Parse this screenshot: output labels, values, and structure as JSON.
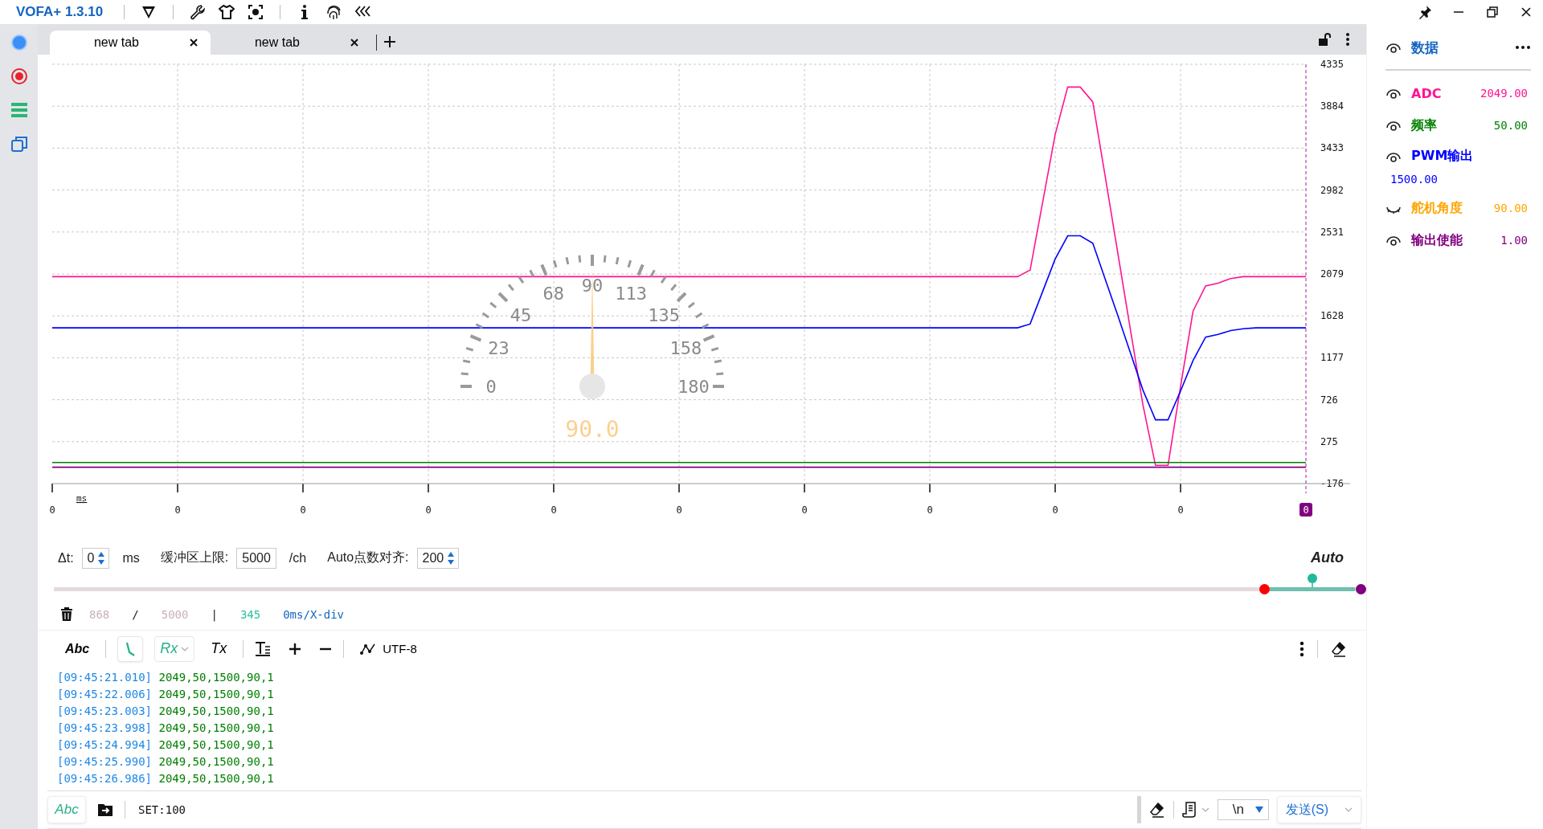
{
  "app": {
    "title": "VOFA+ 1.3.10"
  },
  "tabs": [
    {
      "label": "new tab",
      "selected": true
    },
    {
      "label": "new tab",
      "selected": false
    }
  ],
  "chart": {
    "unit_label": "ms",
    "chart_data": {
      "type": "line",
      "grid": true,
      "categories": [
        "0",
        null,
        null,
        null,
        null,
        null,
        null,
        null,
        null,
        null,
        "0",
        null,
        null,
        null,
        null,
        null,
        null,
        null,
        null,
        null,
        "0",
        null,
        null,
        null,
        null,
        null,
        null,
        null,
        null,
        null,
        "0",
        null,
        null,
        null,
        null,
        null,
        null,
        null,
        null,
        null,
        "0",
        null,
        null,
        null,
        null,
        null,
        null,
        null,
        null,
        null,
        "0",
        null,
        null,
        null,
        null,
        null,
        null,
        null,
        null,
        null,
        "0",
        null,
        null,
        null,
        null,
        null,
        null,
        null,
        null,
        null,
        "0",
        null,
        null,
        null,
        null,
        null,
        null,
        null,
        null,
        null,
        "0",
        null,
        null,
        null,
        null,
        null,
        null,
        null,
        null,
        null,
        "0",
        null,
        null,
        null,
        null,
        null,
        null,
        null,
        null,
        null,
        "0"
      ],
      "series": [
        {
          "color": "#ff1493",
          "values": [
            2050,
            2050,
            2050,
            2050,
            2050,
            2050,
            2050,
            2050,
            2050,
            2050,
            2050,
            2050,
            2050,
            2050,
            2050,
            2050,
            2050,
            2050,
            2050,
            2050,
            2050,
            2050,
            2050,
            2050,
            2050,
            2050,
            2050,
            2050,
            2050,
            2050,
            2050,
            2050,
            2050,
            2050,
            2050,
            2050,
            2050,
            2050,
            2050,
            2050,
            2050,
            2050,
            2050,
            2050,
            2050,
            2050,
            2050,
            2050,
            2050,
            2050,
            2050,
            2050,
            2050,
            2050,
            2050,
            2050,
            2050,
            2050,
            2050,
            2050,
            2050,
            2050,
            2050,
            2050,
            2050,
            2050,
            2050,
            2050,
            2050,
            2050,
            2050,
            2050,
            2050,
            2050,
            2050,
            2050,
            2050,
            2050,
            2120,
            2850,
            3580,
            4090,
            4090,
            3930,
            3120,
            2300,
            1480,
            670,
            20,
            20,
            870,
            1680,
            1950,
            1980,
            2030,
            2050,
            2050,
            2050,
            2050,
            2050,
            2050
          ]
        },
        {
          "color": "#0000ff",
          "values": [
            1500,
            1500,
            1500,
            1500,
            1500,
            1500,
            1500,
            1500,
            1500,
            1500,
            1500,
            1500,
            1500,
            1500,
            1500,
            1500,
            1500,
            1500,
            1500,
            1500,
            1500,
            1500,
            1500,
            1500,
            1500,
            1500,
            1500,
            1500,
            1500,
            1500,
            1500,
            1500,
            1500,
            1500,
            1500,
            1500,
            1500,
            1500,
            1500,
            1500,
            1500,
            1500,
            1500,
            1500,
            1500,
            1500,
            1500,
            1500,
            1500,
            1500,
            1500,
            1500,
            1500,
            1500,
            1500,
            1500,
            1500,
            1500,
            1500,
            1500,
            1500,
            1500,
            1500,
            1500,
            1500,
            1500,
            1500,
            1500,
            1500,
            1500,
            1500,
            1500,
            1500,
            1500,
            1500,
            1500,
            1500,
            1500,
            1540,
            1890,
            2240,
            2490,
            2490,
            2410,
            2020,
            1630,
            1230,
            830,
            510,
            510,
            820,
            1150,
            1400,
            1430,
            1470,
            1490,
            1500,
            1500,
            1500,
            1500,
            1500
          ]
        },
        {
          "color": "#008000",
          "values": [
            50,
            50,
            50,
            50,
            50,
            50,
            50,
            50,
            50,
            50,
            50,
            50,
            50,
            50,
            50,
            50,
            50,
            50,
            50,
            50,
            50,
            50,
            50,
            50,
            50,
            50,
            50,
            50,
            50,
            50,
            50,
            50,
            50,
            50,
            50,
            50,
            50,
            50,
            50,
            50,
            50,
            50,
            50,
            50,
            50,
            50,
            50,
            50,
            50,
            50,
            50,
            50,
            50,
            50,
            50,
            50,
            50,
            50,
            50,
            50,
            50,
            50,
            50,
            50,
            50,
            50,
            50,
            50,
            50,
            50,
            50,
            50,
            50,
            50,
            50,
            50,
            50,
            50,
            50,
            50,
            50,
            50,
            50,
            50,
            50,
            50,
            50,
            50,
            50,
            50,
            50,
            50,
            50,
            50,
            50,
            50,
            50,
            50,
            50,
            50,
            50
          ]
        },
        {
          "color": "#800080",
          "values": [
            0,
            0,
            0,
            0,
            0,
            0,
            0,
            0,
            0,
            0,
            0,
            0,
            0,
            0,
            0,
            0,
            0,
            0,
            0,
            0,
            0,
            0,
            0,
            0,
            0,
            0,
            0,
            0,
            0,
            0,
            0,
            0,
            0,
            0,
            0,
            0,
            0,
            0,
            0,
            0,
            0,
            0,
            0,
            0,
            0,
            0,
            0,
            0,
            0,
            0,
            0,
            0,
            0,
            0,
            0,
            0,
            0,
            0,
            0,
            0,
            0,
            0,
            0,
            0,
            0,
            0,
            0,
            0,
            0,
            0,
            0,
            0,
            0,
            0,
            0,
            0,
            0,
            0,
            0,
            0,
            0,
            0,
            0,
            0,
            0,
            0,
            0,
            0,
            0,
            0,
            0,
            0,
            0,
            0,
            0,
            0,
            0,
            0,
            0,
            0,
            0
          ]
        }
      ],
      "ylim": [
        -176,
        4335
      ],
      "yticks": [
        -176,
        275,
        726,
        1177,
        1628,
        2079,
        2531,
        2982,
        3433,
        3884,
        4335
      ]
    }
  },
  "gauge": {
    "ticks": [
      "0",
      "23",
      "45",
      "68",
      "90",
      "113",
      "135",
      "158",
      "180"
    ],
    "level": 0.5,
    "reading": "90.0"
  },
  "controls": {
    "dt": {
      "label": "Δt:",
      "value": "0",
      "unit": "ms"
    },
    "buffer": {
      "label": "缓冲区上限:",
      "value": "5000",
      "unit": "/ch"
    },
    "align": {
      "label": "Auto点数对齐:",
      "value": "200"
    },
    "mode": "Auto"
  },
  "range_slider": {
    "start": {
      "level": 0.926
    },
    "end": {
      "level": 1
    }
  },
  "stats": {
    "count": "868",
    "slash": "/",
    "limit": "5000",
    "bar": "|",
    "visible": "345",
    "scale": "0ms/X-div"
  },
  "toolbar": {
    "text_mode": "Abc",
    "timestamp": {
      "selected": true
    },
    "rx": {
      "label": "Rx",
      "selected": true
    },
    "tx": "Tx",
    "encoding": "UTF-8"
  },
  "log": [
    {
      "time": "[09:45:21.010]",
      "data": "2049,50,1500,90,1"
    },
    {
      "time": "[09:45:22.006]",
      "data": "2049,50,1500,90,1"
    },
    {
      "time": "[09:45:23.003]",
      "data": "2049,50,1500,90,1"
    },
    {
      "time": "[09:45:23.998]",
      "data": "2049,50,1500,90,1"
    },
    {
      "time": "[09:45:24.994]",
      "data": "2049,50,1500,90,1"
    },
    {
      "time": "[09:45:25.990]",
      "data": "2049,50,1500,90,1"
    },
    {
      "time": "[09:45:26.986]",
      "data": "2049,50,1500,90,1"
    }
  ],
  "send": {
    "mode": "Abc",
    "value": "SET:100",
    "line_ending": "\\n",
    "button": "发送(S)"
  },
  "panel": {
    "title": "数据",
    "channels": [
      {
        "name": "ADC",
        "value": "2049.00",
        "color": "#ff1493",
        "visible": true
      },
      {
        "name": "频率",
        "value": "50.00",
        "color": "#008000",
        "visible": true
      },
      {
        "name": "PWM输出",
        "value": "1500.00",
        "color": "#0000ff",
        "visible": true
      },
      {
        "name": "舵机角度",
        "value": "90.00",
        "color": "#ffa500",
        "visible": false
      },
      {
        "name": "输出使能",
        "value": "1.00",
        "color": "#800080",
        "visible": true
      }
    ]
  }
}
